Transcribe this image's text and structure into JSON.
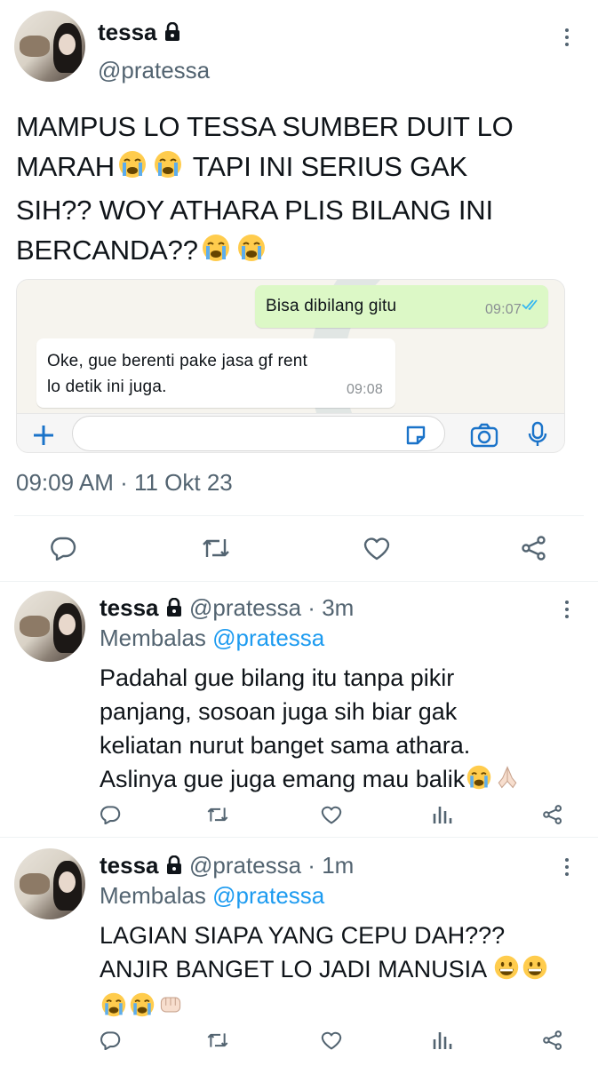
{
  "main_tweet": {
    "name": "tessa",
    "handle": "@pratessa",
    "text_line1": "MAMPUS LO TESSA SUMBER DUIT LO",
    "text_line2_a": "MARAH",
    "text_line2_b": " TAPI INI SERIUS GAK",
    "text_line3": "SIH?? WOY ATHARA PLIS BILANG INI",
    "text_line4": "BERCANDA??",
    "timestamp": "09:09 AM · 11 Okt 23"
  },
  "whatsapp": {
    "outgoing_text": "Bisa dibilang gitu",
    "outgoing_time": "09:07",
    "incoming_line1": "Oke, gue berenti pake jasa gf rent",
    "incoming_line2": "lo detik ini juga.",
    "incoming_time": "09:08"
  },
  "replies": [
    {
      "name": "tessa",
      "handle_time": "@pratessa · 3m",
      "replying_prefix": "Membalas ",
      "replying_to": "@pratessa",
      "line1": "Padahal gue bilang itu tanpa pikir",
      "line2": "panjang, sosoan juga sih biar gak",
      "line3": "keliatan nurut banget sama athara.",
      "line4": "Aslinya gue juga emang mau balik"
    },
    {
      "name": "tessa",
      "handle_time": "@pratessa · 1m",
      "replying_prefix": "Membalas ",
      "replying_to": "@pratessa",
      "line1": "LAGIAN SIAPA YANG CEPU DAH???",
      "line2": "ANJIR BANGET LO JADI MANUSIA "
    }
  ],
  "icons": [
    "lock-icon",
    "more-icon",
    "reply-icon",
    "retweet-icon",
    "like-icon",
    "share-icon",
    "views-icon",
    "plus-icon",
    "sticker-icon",
    "camera-icon",
    "mic-icon",
    "double-check-icon"
  ],
  "colors": {
    "accent": "#1d9bf0",
    "muted": "#536471",
    "wa_green": "#dcf8c6",
    "wa_blue": "#34b7f1"
  }
}
